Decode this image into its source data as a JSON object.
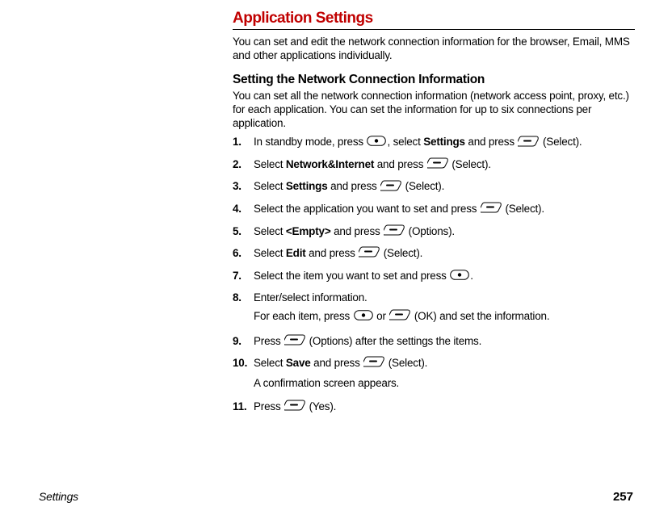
{
  "heading": "Application Settings",
  "intro": "You can set and edit the network connection information for the browser, Email, MMS and other applications individually.",
  "subheading": "Setting the Network Connection Information",
  "subintro": "You can set all the network connection information (network access point, proxy, etc.) for each application. You can set the information for up to six connections per application.",
  "steps": {
    "s1": {
      "num": "1.",
      "a": "In standby mode, press ",
      "b": ", select ",
      "bold1": "Settings",
      "c": " and press ",
      "d": " (Select)."
    },
    "s2": {
      "num": "2.",
      "a": "Select ",
      "bold1": "Network&Internet",
      "b": " and press ",
      "c": " (Select)."
    },
    "s3": {
      "num": "3.",
      "a": "Select ",
      "bold1": "Settings",
      "b": " and press ",
      "c": " (Select)."
    },
    "s4": {
      "num": "4.",
      "a": "Select the application you want to set and press ",
      "b": " (Select)."
    },
    "s5": {
      "num": "5.",
      "a": "Select ",
      "bold1": "<Empty>",
      "b": " and press ",
      "c": " (Options)."
    },
    "s6": {
      "num": "6.",
      "a": "Select ",
      "bold1": "Edit",
      "b": " and press ",
      "c": " (Select)."
    },
    "s7": {
      "num": "7.",
      "a": "Select the item you want to set and press ",
      "b": "."
    },
    "s8": {
      "num": "8.",
      "a": "Enter/select information.",
      "extra_a": "For each item, press ",
      "extra_b": " or ",
      "extra_c": " (OK) and set the information."
    },
    "s9": {
      "num": "9.",
      "a": "Press ",
      "b": " (Options) after the settings the items."
    },
    "s10": {
      "num": "10.",
      "a": "Select ",
      "bold1": "Save",
      "b": " and press ",
      "c": " (Select).",
      "extra": "A confirmation screen appears."
    },
    "s11": {
      "num": "11.",
      "a": "Press ",
      "b": " (Yes)."
    }
  },
  "footer": {
    "section": "Settings",
    "page": "257"
  }
}
